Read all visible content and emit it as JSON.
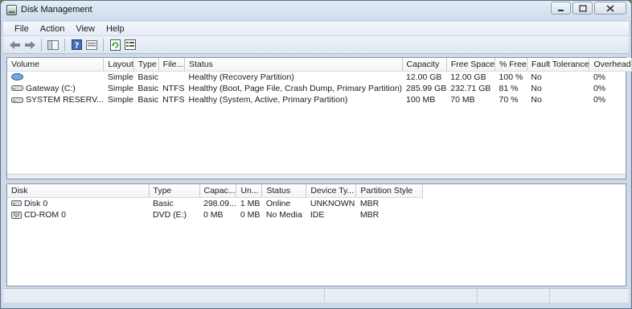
{
  "window": {
    "title": "Disk Management"
  },
  "menu": {
    "items": [
      "File",
      "Action",
      "View",
      "Help"
    ]
  },
  "toolbar": {
    "buttons": [
      "back-icon",
      "forward-icon",
      "console-tree-icon",
      "help-icon",
      "properties-icon",
      "refresh-icon",
      "export-list-icon"
    ]
  },
  "volumes": {
    "headers": [
      "Volume",
      "Layout",
      "Type",
      "File...",
      "Status",
      "Capacity",
      "Free Space",
      "% Free",
      "Fault Tolerance",
      "Overhead"
    ],
    "rows": [
      [
        "",
        "Simple",
        "Basic",
        "",
        "Healthy (Recovery Partition)",
        "12.00 GB",
        "12.00 GB",
        "100 %",
        "No",
        "0%"
      ],
      [
        "Gateway (C:)",
        "Simple",
        "Basic",
        "NTFS",
        "Healthy (Boot, Page File, Crash Dump, Primary Partition)",
        "285.99 GB",
        "232.71 GB",
        "81 %",
        "No",
        "0%"
      ],
      [
        "SYSTEM RESERV...",
        "Simple",
        "Basic",
        "NTFS",
        "Healthy (System, Active, Primary Partition)",
        "100 MB",
        "70 MB",
        "70 %",
        "No",
        "0%"
      ]
    ]
  },
  "disks": {
    "headers": [
      "Disk",
      "Type",
      "Capac...",
      "Un...",
      "Status",
      "Device Ty...",
      "Partition Style"
    ],
    "rows": [
      [
        "Disk 0",
        "Basic",
        "298.09...",
        "1 MB",
        "Online",
        "UNKNOWN",
        "MBR"
      ],
      [
        "CD-ROM 0",
        "DVD (E:)",
        "0 MB",
        "0 MB",
        "No Media",
        "IDE",
        "MBR"
      ]
    ]
  }
}
